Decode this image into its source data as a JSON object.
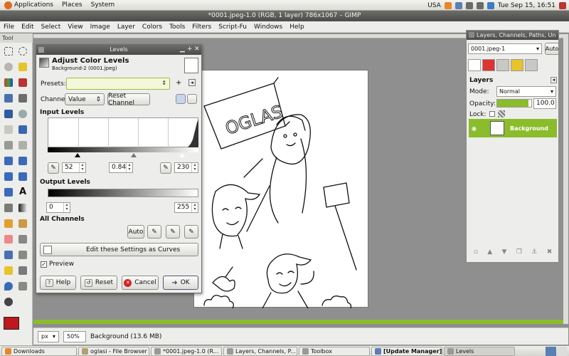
{
  "top_panel": {
    "menus": [
      "Applications",
      "Places",
      "System"
    ],
    "locale": "USA",
    "datetime": "Tue Sep 15, 16:51"
  },
  "image_window": {
    "title": "*0001.jpeg-1.0 (RGB, 1 layer) 786x1067 – GIMP",
    "menu": [
      "File",
      "Edit",
      "Select",
      "View",
      "Image",
      "Layer",
      "Colors",
      "Tools",
      "Filters",
      "Script-Fu",
      "Windows",
      "Help"
    ],
    "status": {
      "unit": "px",
      "zoom": "50%",
      "info": "Background (13.6 MB)"
    }
  },
  "toolbox": {
    "title": "Tool"
  },
  "levels": {
    "window_title": "Levels",
    "heading": "Adjust Color Levels",
    "subheading": "Background-2 (0001.jpeg)",
    "presets_label": "Presets:",
    "channel_label": "Channel:",
    "channel_value": "Value",
    "reset_channel": "Reset Channel",
    "input_levels_label": "Input Levels",
    "input_black": "52",
    "input_gamma": "0.84",
    "input_white": "230",
    "output_levels_label": "Output Levels",
    "output_black": "0",
    "output_white": "255",
    "all_channels_label": "All Channels",
    "auto_label": "Auto",
    "curves_button": "Edit these Settings as Curves",
    "preview_label": "Preview",
    "help_button": "Help",
    "reset_button": "Reset",
    "cancel_button": "Cancel",
    "ok_button": "OK"
  },
  "layers_dialog": {
    "title": "Layers, Channels, Paths, Un",
    "image_select": "0001.jpeg-1",
    "auto_button": "Auto",
    "section_label": "Layers",
    "mode_label": "Mode:",
    "mode_value": "Normal",
    "opacity_label": "Opacity:",
    "opacity_value": "100.0",
    "lock_label": "Lock:",
    "layer_name": "Background"
  },
  "taskbar": {
    "tasks": [
      "Downloads",
      "oglasi - File Browser",
      "*0001.jpeg-1.0 (R...",
      "Layers, Channels, P...",
      "Toolbox",
      "[Update Manager]",
      "Levels"
    ]
  },
  "colors": {
    "accent_green": "#8bbc2c",
    "fg_color": "#c0161d",
    "cancel_red": "#d42020"
  }
}
